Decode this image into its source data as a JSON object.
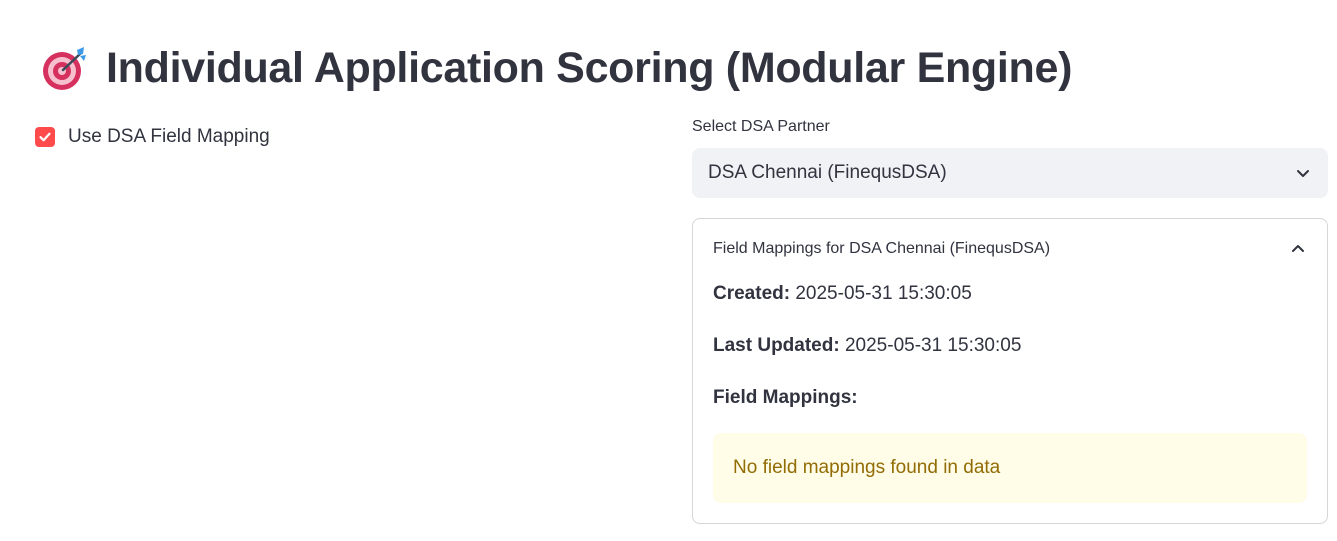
{
  "header": {
    "title": "Individual Application Scoring (Modular Engine)",
    "icon": "direct-hit-target-icon"
  },
  "checkbox": {
    "label": "Use DSA Field Mapping",
    "checked": true,
    "color": "#ff4b4b"
  },
  "dsa_select": {
    "label": "Select DSA Partner",
    "value": "DSA Chennai (FinequsDSA)"
  },
  "expander": {
    "title": "Field Mappings for DSA Chennai (FinequsDSA)",
    "expanded": true,
    "created_label": "Created:",
    "created_value": "2025-05-31 15:30:05",
    "updated_label": "Last Updated:",
    "updated_value": "2025-05-31 15:30:05",
    "mappings_label": "Field Mappings:",
    "warning": "No field mappings found in data"
  },
  "colors": {
    "primary": "#ff4b4b",
    "text": "#31333f",
    "select_bg": "#f0f2f6",
    "warning_bg": "#fffce7",
    "warning_text": "#926c05"
  }
}
